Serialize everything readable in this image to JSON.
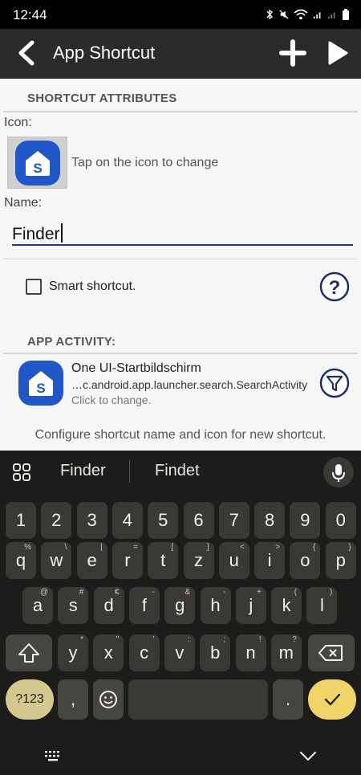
{
  "status_bar": {
    "time": "12:44"
  },
  "app_bar": {
    "title": "App Shortcut"
  },
  "shortcut_attributes": {
    "header": "SHORTCUT ATTRIBUTES",
    "icon_label": "Icon:",
    "icon_hint": "Tap on the icon to change",
    "name_label": "Name:",
    "name_value": "Finder",
    "smart_label": "Smart shortcut."
  },
  "app_activity": {
    "header": "APP ACTIVITY:",
    "title": "One UI-Startbildschirm",
    "activity": "…c.android.app.launcher.search.SearchActivity",
    "hint": "Click to change."
  },
  "footer_note": "Configure shortcut name and icon for new shortcut.",
  "keyboard": {
    "suggestions": [
      "Finder",
      "Findet"
    ],
    "row_numbers": [
      "1",
      "2",
      "3",
      "4",
      "5",
      "6",
      "7",
      "8",
      "9",
      "0"
    ],
    "row_q": [
      {
        "k": "q",
        "a": "%"
      },
      {
        "k": "w",
        "a": "\\"
      },
      {
        "k": "e",
        "a": "|"
      },
      {
        "k": "r",
        "a": "="
      },
      {
        "k": "t",
        "a": "["
      },
      {
        "k": "z",
        "a": "]"
      },
      {
        "k": "u",
        "a": "<"
      },
      {
        "k": "i",
        "a": ">"
      },
      {
        "k": "o",
        "a": "{"
      },
      {
        "k": "p",
        "a": "}"
      }
    ],
    "row_a": [
      {
        "k": "a",
        "a": "@"
      },
      {
        "k": "s",
        "a": "#"
      },
      {
        "k": "d",
        "a": "€"
      },
      {
        "k": "f",
        "a": "-"
      },
      {
        "k": "g",
        "a": "&"
      },
      {
        "k": "h",
        "a": "-"
      },
      {
        "k": "j",
        "a": "+"
      },
      {
        "k": "k",
        "a": "("
      },
      {
        "k": "l",
        "a": ")"
      }
    ],
    "row_y": [
      {
        "k": "y",
        "a": "*"
      },
      {
        "k": "x",
        "a": "\""
      },
      {
        "k": "c",
        "a": "'"
      },
      {
        "k": "v",
        "a": ":"
      },
      {
        "k": "b",
        "a": ";"
      },
      {
        "k": "n",
        "a": "!"
      },
      {
        "k": "m",
        "a": "?"
      }
    ],
    "sym_label": "?123",
    "comma": ",",
    "period": "."
  },
  "colors": {
    "app_bar": "#2b2b2b",
    "accent": "#1f56c8",
    "input_underline": "#233a8c",
    "keyboard_bg": "#1d1c1a",
    "enter_key": "#f0d46a"
  }
}
